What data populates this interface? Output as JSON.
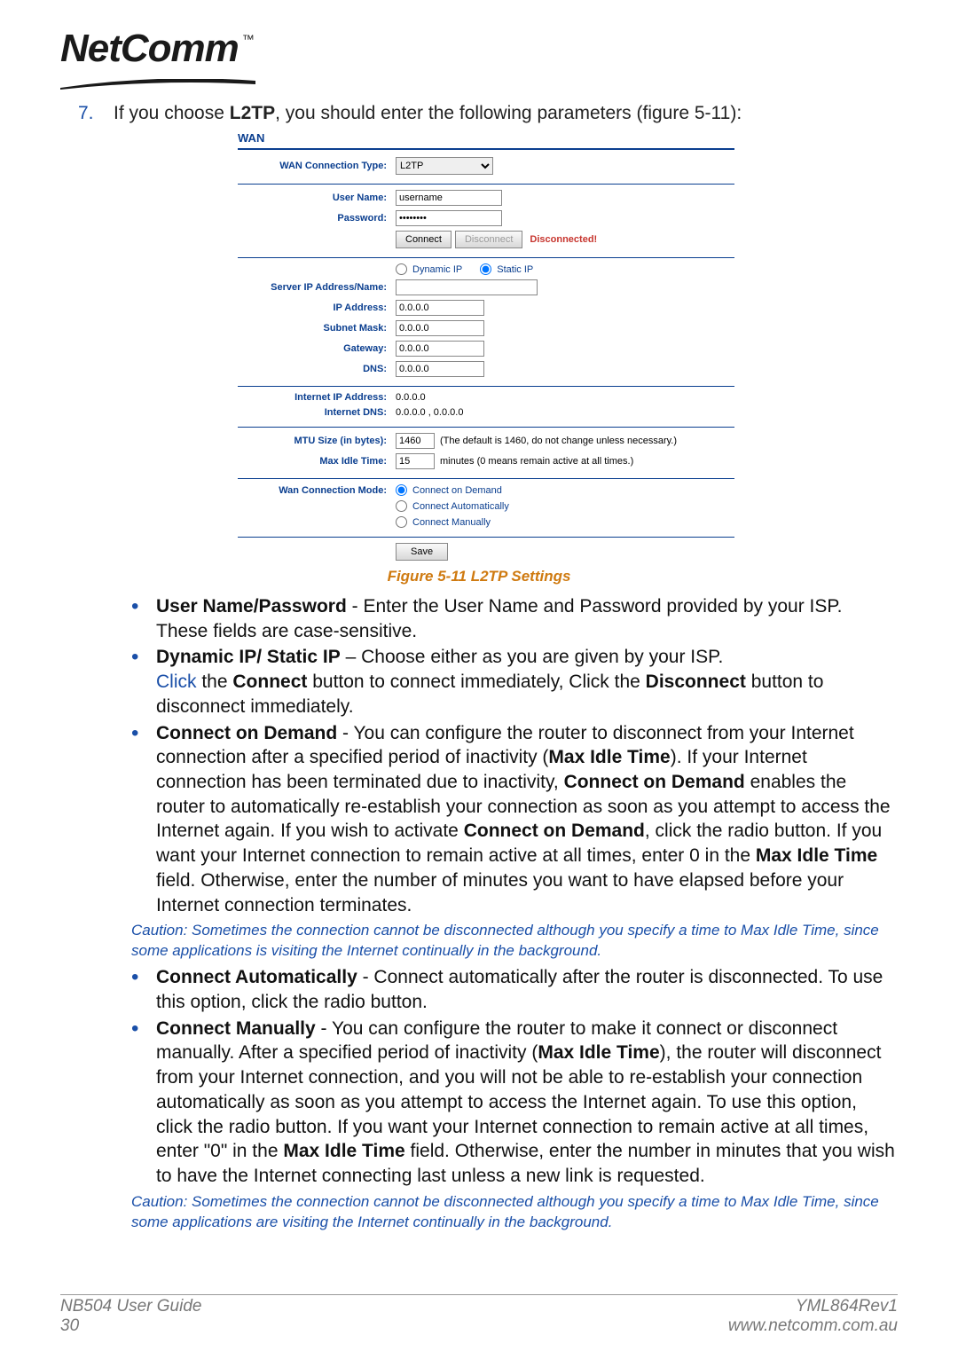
{
  "logo": {
    "brand": "NetComm",
    "tm": "™"
  },
  "numbered": {
    "num": "7.",
    "pre": "If you choose ",
    "bold": "L2TP",
    "post": ", you should enter the following parameters (figure 5-11):"
  },
  "wan": {
    "title": "WAN",
    "labels": {
      "conn_type": "WAN Connection Type:",
      "user": "User Name:",
      "pass": "Password:",
      "server": "Server IP Address/Name:",
      "ip": "IP Address:",
      "subnet": "Subnet Mask:",
      "gateway": "Gateway:",
      "dns": "DNS:",
      "inet_ip": "Internet IP Address:",
      "inet_dns": "Internet DNS:",
      "mtu": "MTU Size (in bytes):",
      "max_idle": "Max Idle Time:",
      "mode": "Wan Connection Mode:"
    },
    "values": {
      "conn_type": "L2TP",
      "user": "username",
      "pass": "••••••••",
      "server": "",
      "ip": "0.0.0.0",
      "subnet": "0.0.0.0",
      "gateway": "0.0.0.0",
      "dns": "0.0.0.0",
      "inet_ip": "0.0.0.0",
      "inet_dns": "0.0.0.0 , 0.0.0.0",
      "mtu": "1460",
      "max_idle": "15"
    },
    "hints": {
      "mtu": "(The default is 1460, do not change unless necessary.)",
      "max_idle": "minutes (0 means remain active at all times.)"
    },
    "buttons": {
      "connect": "Connect",
      "disconnect": "Disconnect",
      "save": "Save"
    },
    "status": "Disconnected!",
    "ip_mode": {
      "dynamic": "Dynamic IP",
      "static": "Static IP"
    },
    "modes": {
      "demand": "Connect on Demand",
      "auto": "Connect Automatically",
      "manual": "Connect Manually"
    }
  },
  "figure_caption": "Figure 5-11 L2TP Settings",
  "bullets": {
    "b1_bold": "User Name/Password",
    "b1_text": " - Enter the User Name and Password provided by your ISP. These fields are case-sensitive.",
    "b2_bold": "Dynamic IP/ Static IP",
    "b2_line1": " – Choose either as you are given by your ISP.",
    "b2_click": "Click",
    "b2_mid1": " the ",
    "b2_connect": "Connect",
    "b2_mid2": " button to connect immediately, Click the ",
    "b2_disconnect": "Disconnect",
    "b2_end": " button to disconnect immediately.",
    "b3_bold": "Connect on Demand",
    "b3_p1": " - You can configure the router to disconnect from your Internet connection after a specified period of inactivity (",
    "b3_mit": "Max Idle Time",
    "b3_p2": "). If your Internet connection has been terminated due to inactivity, ",
    "b3_cod": "Connect on Demand",
    "b3_p3": " enables the router to automatically re-establish your connection as soon as you attempt to access the Internet again. If you wish to activate ",
    "b3_cod2": "Connect on Demand",
    "b3_p4": ", click the radio button. If you want your Internet connection to remain active at all times, enter 0 in the ",
    "b3_mit2": "Max Idle Time",
    "b3_p5": " field. Otherwise, enter the number of minutes you want to have elapsed before your Internet connection terminates.",
    "b4_bold": "Connect Automatically",
    "b4_text": " - Connect automatically after the router is disconnected. To use this option, click the radio button.",
    "b5_bold": "Connect Manually",
    "b5_p1": " - You can configure the router to make it connect or disconnect manually. After a specified period of inactivity (",
    "b5_mit": "Max Idle Time",
    "b5_p2": "), the router will disconnect from your Internet connection, and you will not be able to re-establish your connection automatically as soon as you attempt to access the Internet again. To use this option, click the radio button. If you want your Internet connection to remain active at all times, enter \"0\" in the ",
    "b5_mit2": "Max Idle Time",
    "b5_p3": " field. Otherwise, enter the number in minutes that you wish to have the Internet connecting last unless a new link is requested."
  },
  "caution1": "Caution: Sometimes the connection cannot be disconnected although you specify a time to Max Idle Time, since some applications is visiting the Internet continually in the background.",
  "caution2": "Caution: Sometimes the connection cannot be disconnected although you specify a time to Max Idle Time, since some applications are visiting the Internet continually in the background.",
  "footer": {
    "left1": "NB504 User Guide",
    "left2": "30",
    "right1": "YML864Rev1",
    "right2": "www.netcomm.com.au"
  }
}
